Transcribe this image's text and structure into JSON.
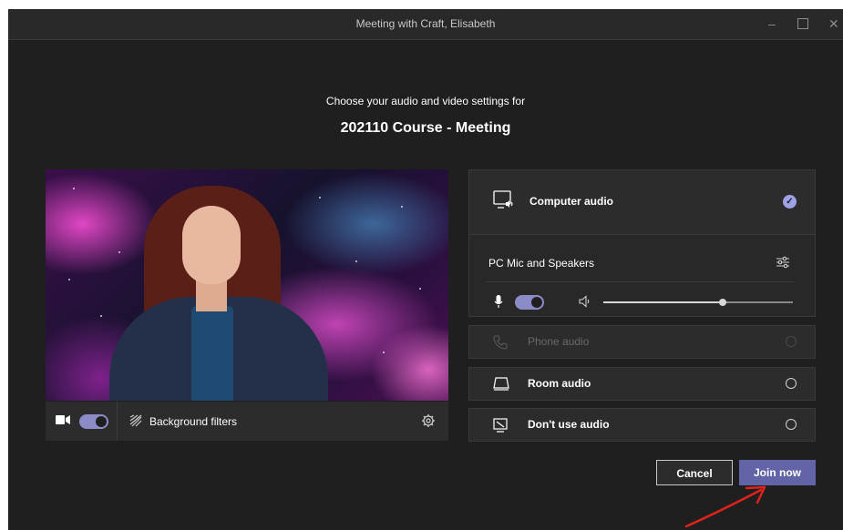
{
  "window": {
    "title": "Meeting with Craft, Elisabeth"
  },
  "header": {
    "subtitle": "Choose your audio and video settings for",
    "meeting_title": "202110 Course - Meeting"
  },
  "video": {
    "camera_on": true,
    "background_filters_label": "Background filters",
    "icons": [
      "camera-icon",
      "background-filters-icon",
      "settings-gear-icon"
    ]
  },
  "audio": {
    "computer_audio": {
      "label": "Computer audio",
      "selected": true
    },
    "device": {
      "label": "PC Mic and Speakers",
      "mic_on": true,
      "volume": 0.63
    },
    "phone_audio": {
      "label": "Phone audio",
      "enabled": false
    },
    "room_audio": {
      "label": "Room audio"
    },
    "no_audio": {
      "label": "Don't use audio"
    }
  },
  "buttons": {
    "cancel": "Cancel",
    "join": "Join now"
  },
  "colors": {
    "accent": "#6264a7",
    "toggle": "#8b8cc7",
    "arrow": "#e0221c"
  }
}
